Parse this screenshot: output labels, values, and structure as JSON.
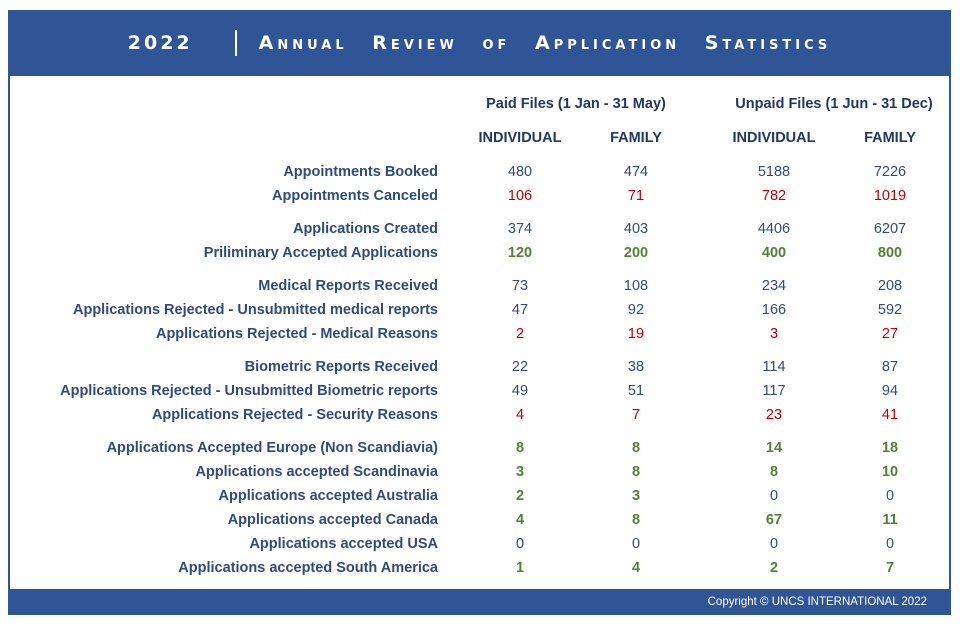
{
  "header": {
    "year": "2022",
    "title": "Annual Review of Application Statistics"
  },
  "groups": [
    {
      "label": "Paid Files (1 Jan - 31 May)"
    },
    {
      "label": "Unpaid Files (1 Jun - 31 Dec)"
    }
  ],
  "columns": [
    "INDIVIDUAL",
    "FAMILY",
    "INDIVIDUAL",
    "FAMILY"
  ],
  "colors": {
    "normal": "#2f4b7c",
    "red": "#c00000",
    "green": "#538135",
    "brand": "#2f5597"
  },
  "rows": [
    {
      "label": "Appointments Booked",
      "values": [
        "480",
        "474",
        "5188",
        "7226"
      ],
      "styles": [
        "normal",
        "normal",
        "normal",
        "normal"
      ]
    },
    {
      "label": "Appointments Canceled",
      "values": [
        "106",
        "71",
        "782",
        "1019"
      ],
      "styles": [
        "red",
        "red",
        "red",
        "red"
      ]
    },
    {
      "label": "Applications Created",
      "values": [
        "374",
        "403",
        "4406",
        "6207"
      ],
      "styles": [
        "normal",
        "normal",
        "normal",
        "normal"
      ]
    },
    {
      "label": "Priliminary Accepted Applications",
      "values": [
        "120",
        "200",
        "400",
        "800"
      ],
      "styles": [
        "green",
        "green",
        "green",
        "green"
      ]
    },
    {
      "label": "Medical Reports Received",
      "values": [
        "73",
        "108",
        "234",
        "208"
      ],
      "styles": [
        "normal",
        "normal",
        "normal",
        "normal"
      ]
    },
    {
      "label": "Applications Rejected - Unsubmitted medical reports",
      "values": [
        "47",
        "92",
        "166",
        "592"
      ],
      "styles": [
        "normal",
        "normal",
        "normal",
        "normal"
      ]
    },
    {
      "label": "Applications Rejected - Medical Reasons",
      "values": [
        "2",
        "19",
        "3",
        "27"
      ],
      "styles": [
        "red",
        "red",
        "red",
        "red"
      ]
    },
    {
      "label": "Biometric Reports Received",
      "values": [
        "22",
        "38",
        "114",
        "87"
      ],
      "styles": [
        "normal",
        "normal",
        "normal",
        "normal"
      ]
    },
    {
      "label": "Applications Rejected - Unsubmitted Biometric reports",
      "values": [
        "49",
        "51",
        "117",
        "94"
      ],
      "styles": [
        "normal",
        "normal",
        "normal",
        "normal"
      ]
    },
    {
      "label": "Applications Rejected - Security Reasons",
      "values": [
        "4",
        "7",
        "23",
        "41"
      ],
      "styles": [
        "red",
        "red",
        "red",
        "red"
      ]
    },
    {
      "label": "Applications Accepted Europe (Non Scandiavia)",
      "values": [
        "8",
        "8",
        "14",
        "18"
      ],
      "styles": [
        "green",
        "green",
        "green",
        "green"
      ]
    },
    {
      "label": "Applications accepted Scandinavia",
      "values": [
        "3",
        "8",
        "8",
        "10"
      ],
      "styles": [
        "green",
        "green",
        "green",
        "green"
      ]
    },
    {
      "label": "Applications accepted Australia",
      "values": [
        "2",
        "3",
        "0",
        "0"
      ],
      "styles": [
        "green",
        "green",
        "normal",
        "normal"
      ]
    },
    {
      "label": "Applications accepted Canada",
      "values": [
        "4",
        "8",
        "67",
        "11"
      ],
      "styles": [
        "green",
        "green",
        "green",
        "green"
      ]
    },
    {
      "label": "Applications accepted USA",
      "values": [
        "0",
        "0",
        "0",
        "0"
      ],
      "styles": [
        "normal",
        "normal",
        "normal",
        "normal"
      ]
    },
    {
      "label": "Applications accepted South America",
      "values": [
        "1",
        "4",
        "2",
        "7"
      ],
      "styles": [
        "green",
        "green",
        "green",
        "green"
      ]
    }
  ],
  "footer": {
    "copyright": "Copyright © UNCS INTERNATIONAL 2022"
  }
}
